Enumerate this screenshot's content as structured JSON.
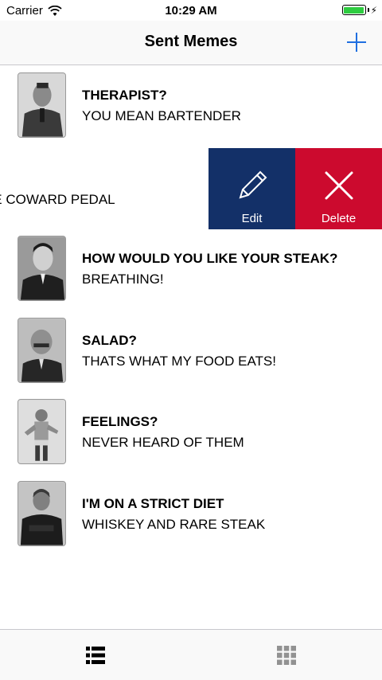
{
  "status_bar": {
    "carrier": "Carrier",
    "time": "10:29 AM",
    "battery_color": "#2ecc40",
    "icons": [
      "wifi-icon",
      "battery-icon",
      "charging-bolt-icon"
    ]
  },
  "nav": {
    "title": "Sent Memes",
    "add_icon": "plus-icon",
    "accent_color": "#1f6fe0"
  },
  "memes": [
    {
      "top": "THERAPIST?",
      "bottom": "YOU MEAN BARTENDER"
    },
    {
      "top": "",
      "bottom": "HE COWARD PEDAL"
    },
    {
      "top": "HOW WOULD YOU LIKE YOUR STEAK?",
      "bottom": "BREATHING!"
    },
    {
      "top": "SALAD?",
      "bottom": "THATS WHAT MY FOOD EATS!"
    },
    {
      "top": "FEELINGS?",
      "bottom": "NEVER HEARD OF THEM"
    },
    {
      "top": "I'M ON A STRICT DIET",
      "bottom": "WHISKEY AND RARE STEAK"
    }
  ],
  "swipe_actions": {
    "edit_label": "Edit",
    "edit_icon": "pencil-icon",
    "edit_color": "#133068",
    "delete_label": "Delete",
    "delete_icon": "close-icon",
    "delete_color": "#cc0a2e"
  },
  "tab_bar": {
    "tabs": [
      {
        "icon": "list-icon",
        "selected": true
      },
      {
        "icon": "grid-icon",
        "selected": false
      }
    ]
  }
}
